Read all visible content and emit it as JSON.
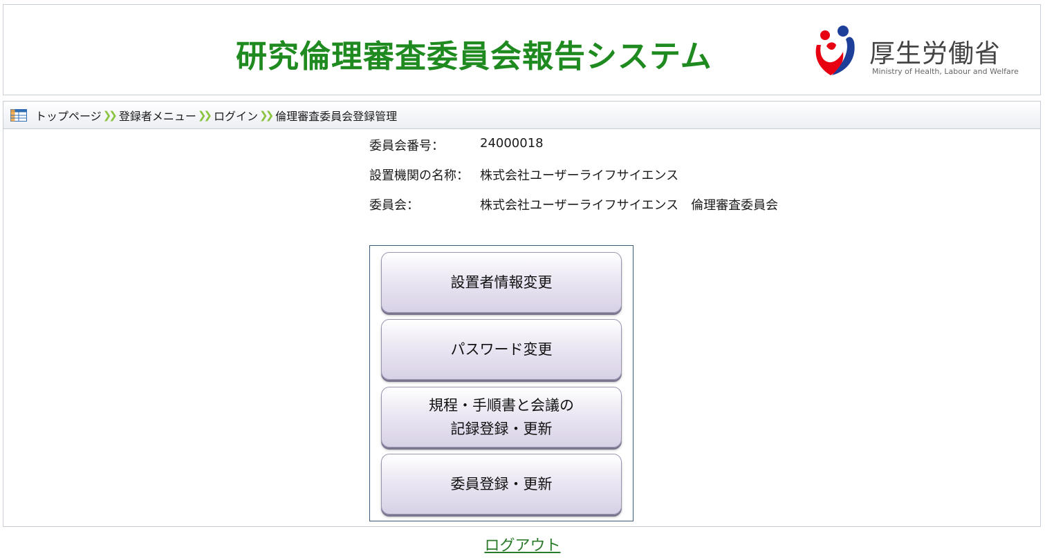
{
  "header": {
    "system_title": "研究倫理審査委員会報告システム",
    "logo_name": "厚生労働省",
    "logo_sub": "Ministry of Health, Labour and Welfare"
  },
  "breadcrumb": {
    "items": [
      "トップページ",
      "登録者メニュー",
      "ログイン",
      "倫理審査委員会登録管理"
    ]
  },
  "info": {
    "committee_number_label": "委員会番号：",
    "committee_number_value": "24000018",
    "institution_label": "設置機関の名称：",
    "institution_value": "株式会社ユーザーライフサイエンス",
    "committee_label": "委員会：",
    "committee_value": "株式会社ユーザーライフサイエンス　倫理審査委員会"
  },
  "menu": {
    "buttons": [
      {
        "lines": [
          "設置者情報変更"
        ]
      },
      {
        "lines": [
          "パスワード変更"
        ]
      },
      {
        "lines": [
          "規程・手順書と会議の",
          "記録登録・更新"
        ]
      },
      {
        "lines": [
          "委員登録・更新"
        ]
      }
    ]
  },
  "footer": {
    "logout_label": "ログアウト"
  },
  "colors": {
    "title_green": "#1f8a1f",
    "breadcrumb_arrow": "#8bc43f",
    "logo_red": "#e60012",
    "logo_blue": "#1d3f9a"
  }
}
